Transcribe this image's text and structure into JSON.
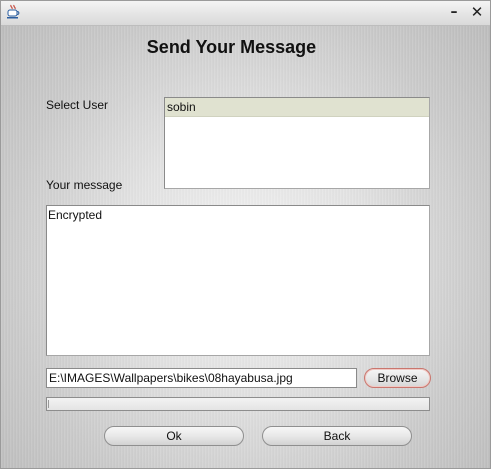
{
  "window": {
    "minimize_glyph": "–",
    "close_glyph": "✕",
    "icon": "java-coffee-cup-icon"
  },
  "heading": "Send Your Message",
  "form": {
    "select_user_label": "Select User",
    "users": [
      "sobin"
    ],
    "selected_user": "sobin",
    "your_message_label": "Your message",
    "message_text": "Encrypted",
    "file_path": "E:\\IMAGES\\Wallpapers\\bikes\\08hayabusa.jpg",
    "browse_label": "Browse",
    "progress": 0
  },
  "actions": {
    "ok_label": "Ok",
    "back_label": "Back"
  },
  "colors": {
    "selected_row": "#e0e2d0",
    "browse_focus_border": "#c9766e"
  }
}
